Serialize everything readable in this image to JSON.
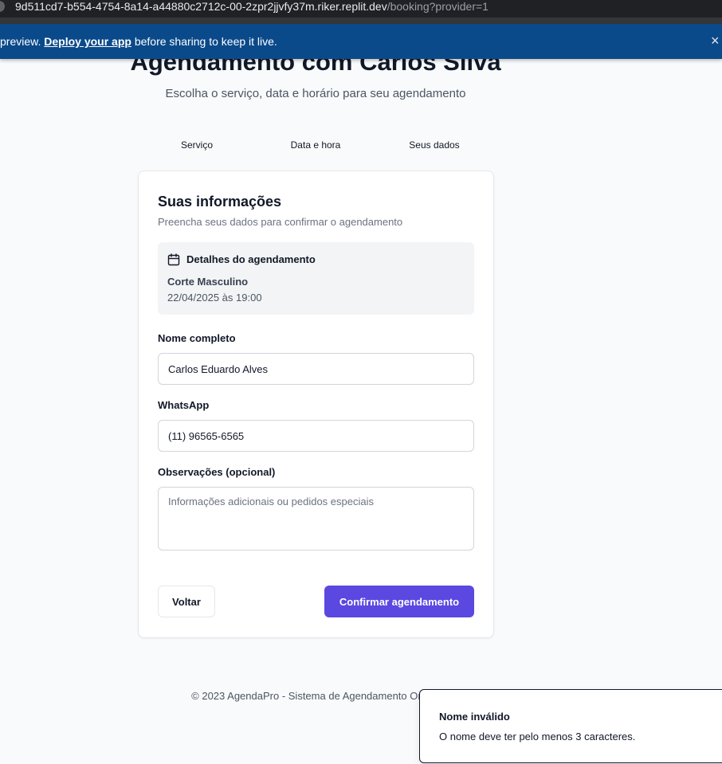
{
  "browser": {
    "url_host": "9d511cd7-b554-4754-8a14-a44880c2712c-00-2zpr2jjvfy37m.riker.replit.dev",
    "url_path": "/booking?provider=1"
  },
  "banner": {
    "prefix": "preview. ",
    "link": "Deploy your app",
    "suffix": " before sharing to keep it live.",
    "close": "×"
  },
  "page": {
    "title": "Agendamento com Carlos Silva",
    "subtitle": "Escolha o serviço, data e horário para seu agendamento"
  },
  "steps": [
    "Serviço",
    "Data e hora",
    "Seus dados"
  ],
  "card": {
    "title": "Suas informações",
    "description": "Preencha seus dados para confirmar o agendamento",
    "details": {
      "title": "Detalhes do agendamento",
      "service": "Corte Masculino",
      "datetime": "22/04/2025 às 19:00",
      "icon": "calendar-icon"
    }
  },
  "form": {
    "name_label": "Nome completo",
    "name_value": "Carlos Eduardo Alves",
    "whatsapp_label": "WhatsApp",
    "whatsapp_value": "(11) 96565-6565",
    "notes_label": "Observações (opcional)",
    "notes_placeholder": "Informações adicionais ou pedidos especiais",
    "back_label": "Voltar",
    "confirm_label": "Confirmar agendamento"
  },
  "footer": {
    "text": "© 2023 AgendaPro - Sistema de Agendamento Online"
  },
  "toast": {
    "title": "Nome inválido",
    "description": "O nome deve ter pelo menos 3 caracteres."
  },
  "colors": {
    "primary": "#5b48e0",
    "banner": "#0b4a8a",
    "background": "#f9fafb"
  }
}
